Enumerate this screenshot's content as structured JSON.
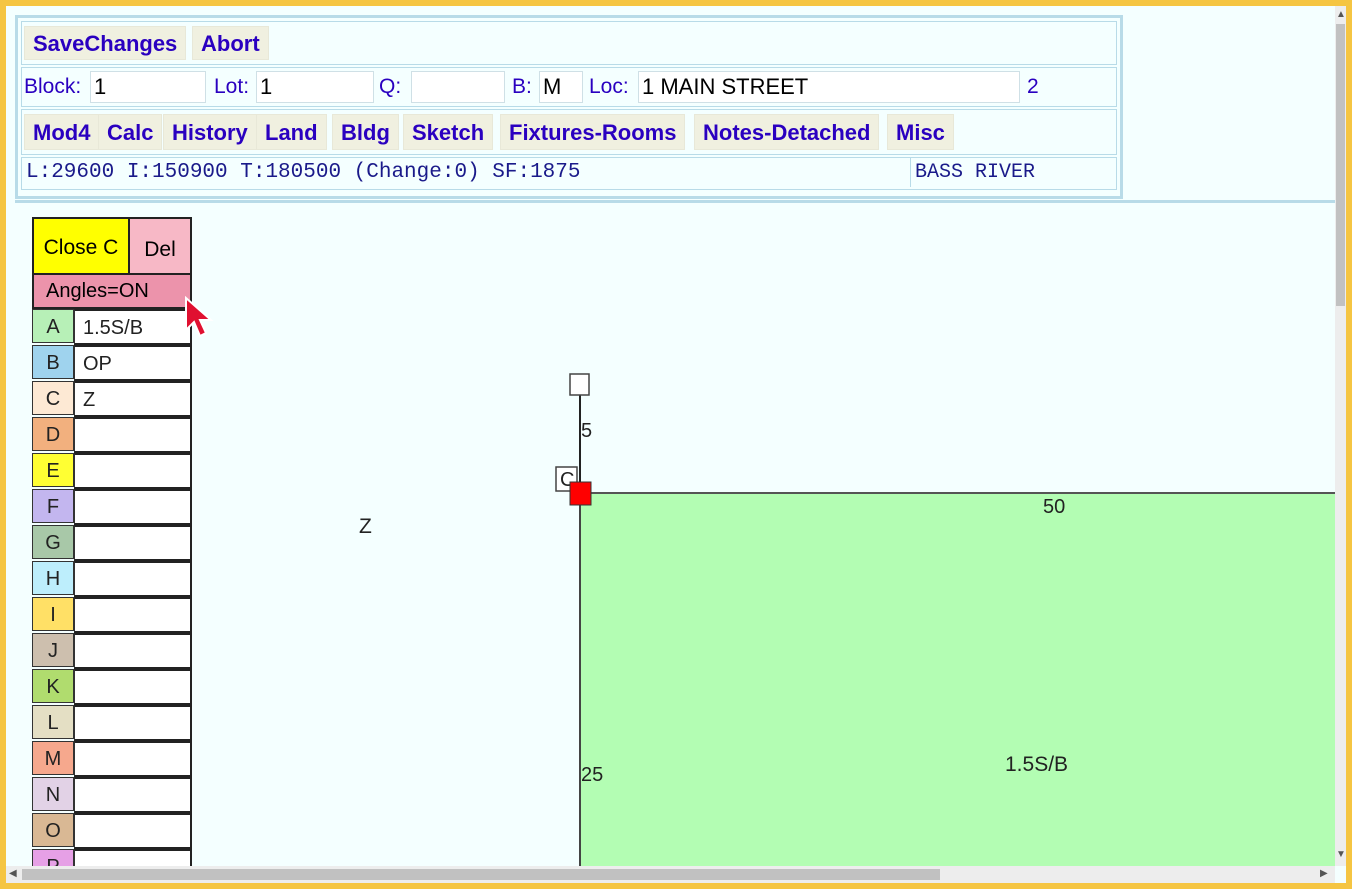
{
  "toolbar": {
    "save": "SaveChanges",
    "abort": "Abort"
  },
  "fields": {
    "block_label": "Block:",
    "block_value": "1",
    "lot_label": "Lot:",
    "lot_value": "1",
    "q_label": "Q:",
    "q_value": "",
    "b_label": "B:",
    "b_value": "M",
    "loc_label": "Loc:",
    "loc_value": "1 MAIN STREET",
    "extra": "2"
  },
  "nav": [
    "Mod4",
    "Calc",
    "History",
    "Land",
    "Bldg",
    "Sketch",
    "Fixtures-Rooms",
    "Notes-Detached",
    "Misc"
  ],
  "values": {
    "summary": "L:29600 I:150900 T:180500 (Change:0) SF:1875",
    "district": "BASS RIVER"
  },
  "panel": {
    "close": "Close C",
    "del": "Del",
    "angles": "Angles=ON",
    "rows": [
      {
        "letter": "A",
        "desc": "1.5S/B",
        "color": "#b7f0b7"
      },
      {
        "letter": "B",
        "desc": "OP",
        "color": "#9fd3ee"
      },
      {
        "letter": "C",
        "desc": "Z",
        "color": "#fde9d4"
      },
      {
        "letter": "D",
        "desc": "",
        "color": "#f2b07e"
      },
      {
        "letter": "E",
        "desc": "",
        "color": "#ffff33"
      },
      {
        "letter": "F",
        "desc": "",
        "color": "#c3b6ef"
      },
      {
        "letter": "G",
        "desc": "",
        "color": "#a8c8a8"
      },
      {
        "letter": "H",
        "desc": "",
        "color": "#bdeefc"
      },
      {
        "letter": "I",
        "desc": "",
        "color": "#ffe066"
      },
      {
        "letter": "J",
        "desc": "",
        "color": "#cdbfae"
      },
      {
        "letter": "K",
        "desc": "",
        "color": "#b0dc6e"
      },
      {
        "letter": "L",
        "desc": "",
        "color": "#e4dfc4"
      },
      {
        "letter": "M",
        "desc": "",
        "color": "#f6a88d"
      },
      {
        "letter": "N",
        "desc": "",
        "color": "#e2d2e6"
      },
      {
        "letter": "O",
        "desc": "",
        "color": "#d9b894"
      },
      {
        "letter": "P",
        "desc": "",
        "color": "#e6a0e6"
      }
    ]
  },
  "sketch": {
    "z_label": "Z",
    "c_label": "C",
    "dim_top": "5",
    "dim_width": "50",
    "dim_height": "25",
    "area_label": "1.5S/B",
    "area_color": "#b3fdb3",
    "handle_color": "#ff0000"
  }
}
